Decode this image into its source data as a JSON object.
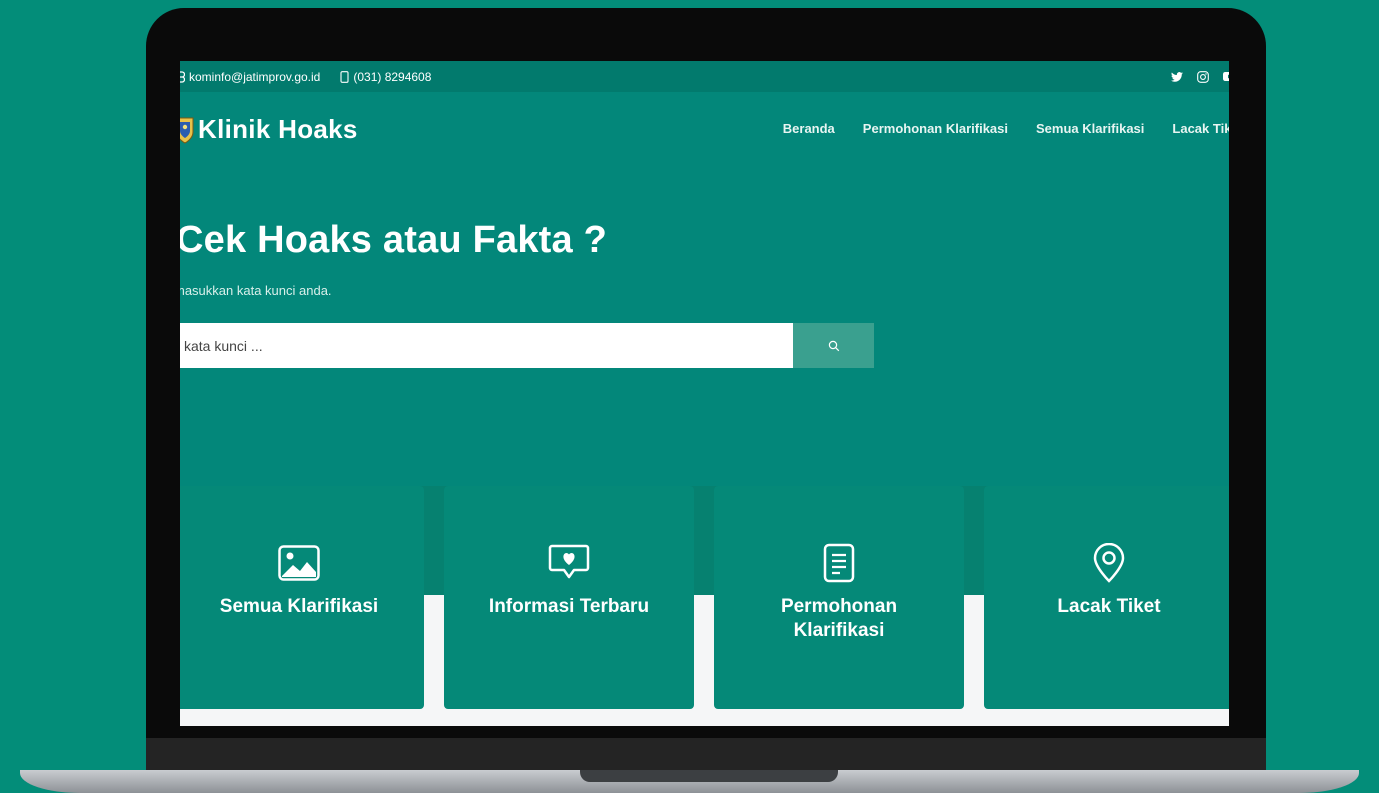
{
  "topbar": {
    "email": "kominfo@jatimprov.go.id",
    "phone": "(031) 8294608",
    "social_icons": [
      "twitter-icon",
      "instagram-icon",
      "youtube-icon"
    ]
  },
  "brand": {
    "title": "Klinik Hoaks",
    "logo_icon": "jatim-emblem-icon"
  },
  "nav": [
    {
      "label": "Beranda"
    },
    {
      "label": "Permohonan Klarifikasi"
    },
    {
      "label": "Semua Klarifikasi"
    },
    {
      "label": "Lacak Tiket"
    }
  ],
  "hero": {
    "title": "Cek Hoaks atau Fakta ?",
    "subtitle": "masukkan kata kunci anda."
  },
  "search": {
    "placeholder": "kata kunci ...",
    "button_icon": "search-icon"
  },
  "cards": [
    {
      "label": "Semua Klarifikasi",
      "icon": "image-icon"
    },
    {
      "label": "Informasi Terbaru",
      "icon": "heart-message-icon"
    },
    {
      "label": "Permohonan Klarifikasi",
      "icon": "document-icon"
    },
    {
      "label": "Lacak Tiket",
      "icon": "location-pin-icon"
    }
  ],
  "colors": {
    "background": "#038d79",
    "screen": "#03877a",
    "topbar": "#027a6d",
    "card": "#058978",
    "search_button": "#3aa08f"
  }
}
